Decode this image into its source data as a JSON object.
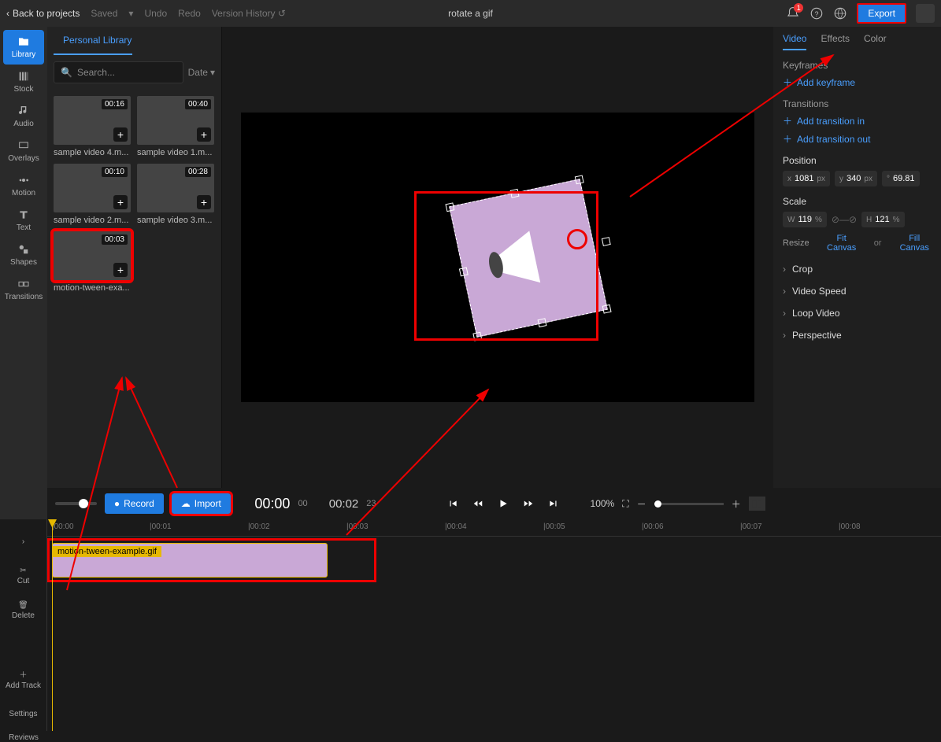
{
  "header": {
    "back": "Back to projects",
    "saved": "Saved",
    "undo": "Undo",
    "redo": "Redo",
    "version": "Version History",
    "title": "rotate a gif",
    "export": "Export",
    "badge": "1"
  },
  "sidebar": {
    "tabs": [
      {
        "label": "Library"
      },
      {
        "label": "Stock"
      },
      {
        "label": "Audio"
      },
      {
        "label": "Overlays"
      },
      {
        "label": "Motion"
      },
      {
        "label": "Text"
      },
      {
        "label": "Shapes"
      },
      {
        "label": "Transitions"
      }
    ],
    "reviews": "Reviews"
  },
  "library": {
    "title": "Personal Library",
    "search_placeholder": "Search...",
    "date": "Date",
    "items": [
      {
        "name": "sample video 4.m...",
        "dur": "00:16"
      },
      {
        "name": "sample video 1.m...",
        "dur": "00:40"
      },
      {
        "name": "sample video 2.m...",
        "dur": "00:10"
      },
      {
        "name": "sample video 3.m...",
        "dur": "00:28"
      },
      {
        "name": "motion-tween-exa...",
        "dur": "00:03"
      }
    ]
  },
  "playbar": {
    "record": "Record",
    "import": "Import",
    "cur_time": "00:00",
    "cur_frames": "00",
    "total_time": "00:02",
    "total_frames": "23",
    "zoom": "100%"
  },
  "timeline": {
    "ticks": [
      "|00:00",
      "|00:01",
      "|00:02",
      "|00:03",
      "|00:04",
      "|00:05",
      "|00:06",
      "|00:07",
      "|00:08"
    ],
    "clip_name": "motion-tween-example.gif",
    "tools": {
      "cut": "Cut",
      "delete": "Delete",
      "add": "Add Track",
      "settings": "Settings"
    }
  },
  "rpanel": {
    "tabs": [
      "Video",
      "Effects",
      "Color"
    ],
    "keyframes": "Keyframes",
    "add_kf": "Add keyframe",
    "transitions": "Transitions",
    "add_tin": "Add transition in",
    "add_tout": "Add transition out",
    "position": "Position",
    "pos_x": "1081",
    "pos_x_unit": "px",
    "pos_y": "340",
    "pos_y_unit": "px",
    "rotation": "69.81",
    "scale": "Scale",
    "scale_w": "119",
    "scale_w_unit": "%",
    "scale_h": "121",
    "scale_h_unit": "%",
    "resize": "Resize",
    "fit": "Fit Canvas",
    "or": "or",
    "fill": "Fill Canvas",
    "acc": [
      "Crop",
      "Video Speed",
      "Loop Video",
      "Perspective"
    ]
  }
}
